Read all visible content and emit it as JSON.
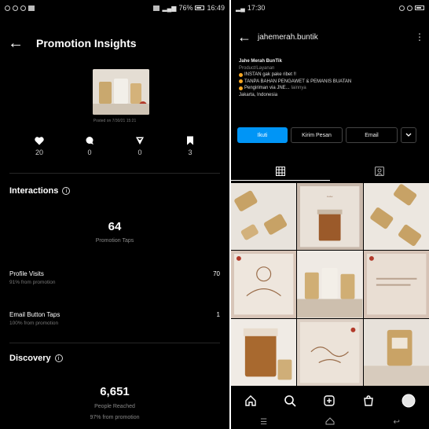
{
  "left": {
    "status": {
      "time": "16:49",
      "battery": "76%"
    },
    "title": "Promotion Insights",
    "post_date": "Posted on 7/30/21 15:21",
    "stats": [
      {
        "icon": "heart-icon",
        "value": "20"
      },
      {
        "icon": "comment-icon",
        "value": "0"
      },
      {
        "icon": "share-icon",
        "value": "0"
      },
      {
        "icon": "bookmark-icon",
        "value": "3"
      }
    ],
    "interactions": {
      "title": "Interactions",
      "total": "64",
      "total_label": "Promotion Taps",
      "rows": [
        {
          "label": "Profile Visits",
          "sub": "91% from promotion",
          "value": "70"
        },
        {
          "label": "Email Button Taps",
          "sub": "100% from promotion",
          "value": "1"
        }
      ]
    },
    "discovery": {
      "title": "Discovery",
      "reach": "6,651",
      "reach_label": "People Reached",
      "reach_sub": "97% from promotion"
    }
  },
  "right": {
    "status": {
      "time": "17:30"
    },
    "username": "jahemerah.buntik",
    "bio": {
      "name": "Jahe Merah BunTik",
      "category": "Product/Layanan",
      "lines": [
        "INSTAN gak pake ribet !!",
        "TANPA BAHAN PENGAWET & PEMANIS BUATAN",
        "Pengiriman via JNE..."
      ],
      "more": "lainnya",
      "location": "Jakarta, Indonesia"
    },
    "buttons": {
      "primary": "Ikuti",
      "message": "Kirim Pesan",
      "email": "Email"
    },
    "colors": {
      "accent": "#0095f6",
      "bullet": "#f5a623"
    }
  }
}
